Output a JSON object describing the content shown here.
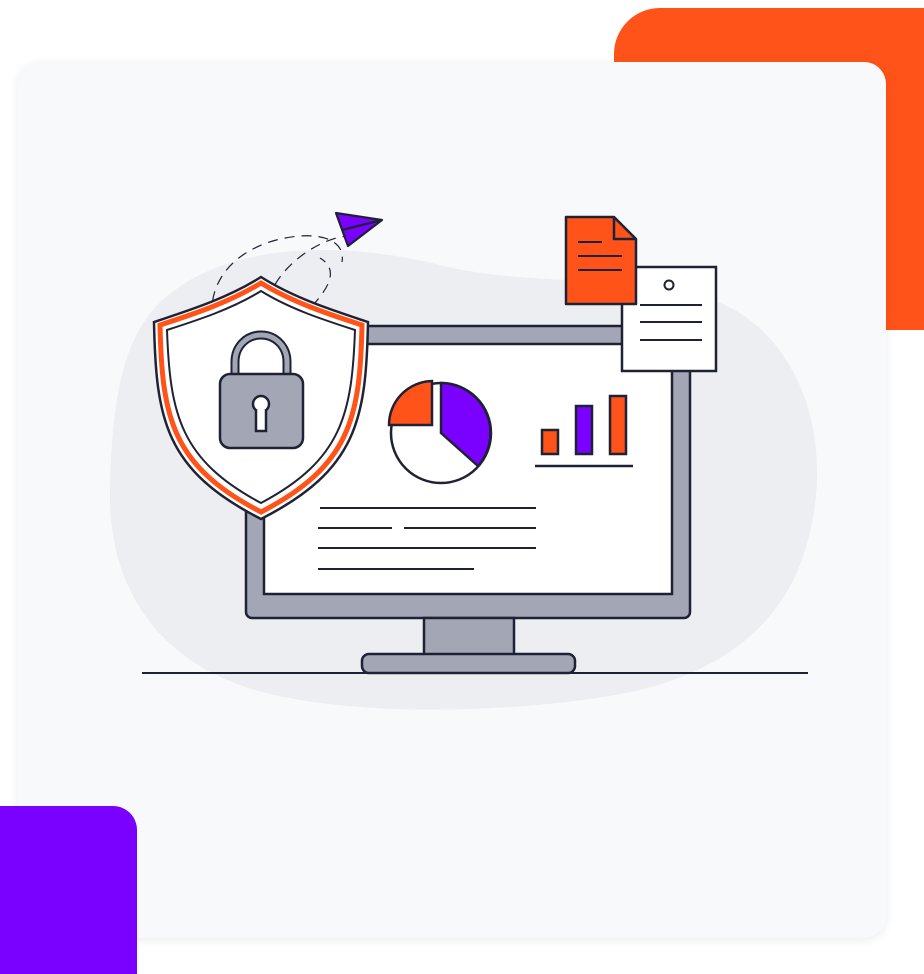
{
  "colors": {
    "page_background": "#ffffff",
    "card_background": "#f8f9fb",
    "accent_orange": "#ff5319",
    "accent_purple": "#7a00ff",
    "blob": "#eceef2",
    "monitor_frame": "#a3a6b4",
    "outline": "#1f2235",
    "screen": "#ffffff"
  },
  "icons": [
    "paper-plane-icon",
    "shield-icon",
    "padlock-icon",
    "pie-chart-icon",
    "bar-chart-icon",
    "document-icon",
    "note-icon",
    "monitor-icon"
  ]
}
